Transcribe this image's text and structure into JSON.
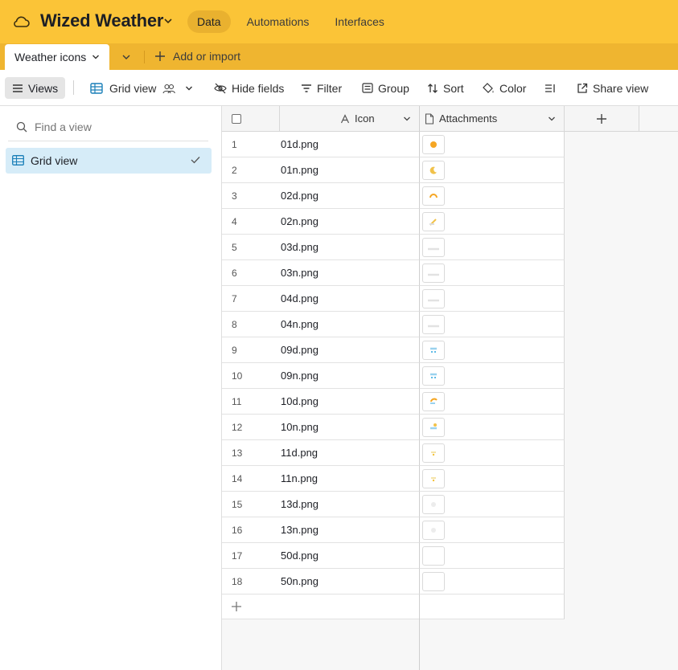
{
  "app": {
    "base_title": "Wized Weather",
    "nav": [
      {
        "label": "Data",
        "active": true
      },
      {
        "label": "Automations",
        "active": false
      },
      {
        "label": "Interfaces",
        "active": false
      }
    ],
    "brand_color": "#fbc437"
  },
  "tabs": {
    "active_table": "Weather icons",
    "add_import": "Add or import"
  },
  "toolbar": {
    "views": "Views",
    "current_view": "Grid view",
    "hide_fields": "Hide fields",
    "filter": "Filter",
    "group": "Group",
    "sort": "Sort",
    "color": "Color",
    "share_view": "Share view"
  },
  "sidebar": {
    "find_placeholder": "Find a view",
    "views": [
      {
        "label": "Grid view",
        "selected": true
      }
    ]
  },
  "grid": {
    "columns": [
      {
        "label": "Icon",
        "type": "text"
      },
      {
        "label": "Attachments",
        "type": "attachment"
      }
    ],
    "rows": [
      {
        "num": "1",
        "icon": "01d.png",
        "thumb": "sun"
      },
      {
        "num": "2",
        "icon": "01n.png",
        "thumb": "moon"
      },
      {
        "num": "3",
        "icon": "02d.png",
        "thumb": "sun-cloud"
      },
      {
        "num": "4",
        "icon": "02n.png",
        "thumb": "moon-cloud"
      },
      {
        "num": "5",
        "icon": "03d.png",
        "thumb": "cloud"
      },
      {
        "num": "6",
        "icon": "03n.png",
        "thumb": "cloud"
      },
      {
        "num": "7",
        "icon": "04d.png",
        "thumb": "cloud"
      },
      {
        "num": "8",
        "icon": "04n.png",
        "thumb": "cloud"
      },
      {
        "num": "9",
        "icon": "09d.png",
        "thumb": "rain"
      },
      {
        "num": "10",
        "icon": "09n.png",
        "thumb": "rain"
      },
      {
        "num": "11",
        "icon": "10d.png",
        "thumb": "sun-rain"
      },
      {
        "num": "12",
        "icon": "10n.png",
        "thumb": "moon-rain"
      },
      {
        "num": "13",
        "icon": "11d.png",
        "thumb": "thunder"
      },
      {
        "num": "14",
        "icon": "11n.png",
        "thumb": "thunder"
      },
      {
        "num": "15",
        "icon": "13d.png",
        "thumb": "snow"
      },
      {
        "num": "16",
        "icon": "13n.png",
        "thumb": "snow"
      },
      {
        "num": "17",
        "icon": "50d.png",
        "thumb": "mist"
      },
      {
        "num": "18",
        "icon": "50n.png",
        "thumb": "mist"
      }
    ]
  }
}
